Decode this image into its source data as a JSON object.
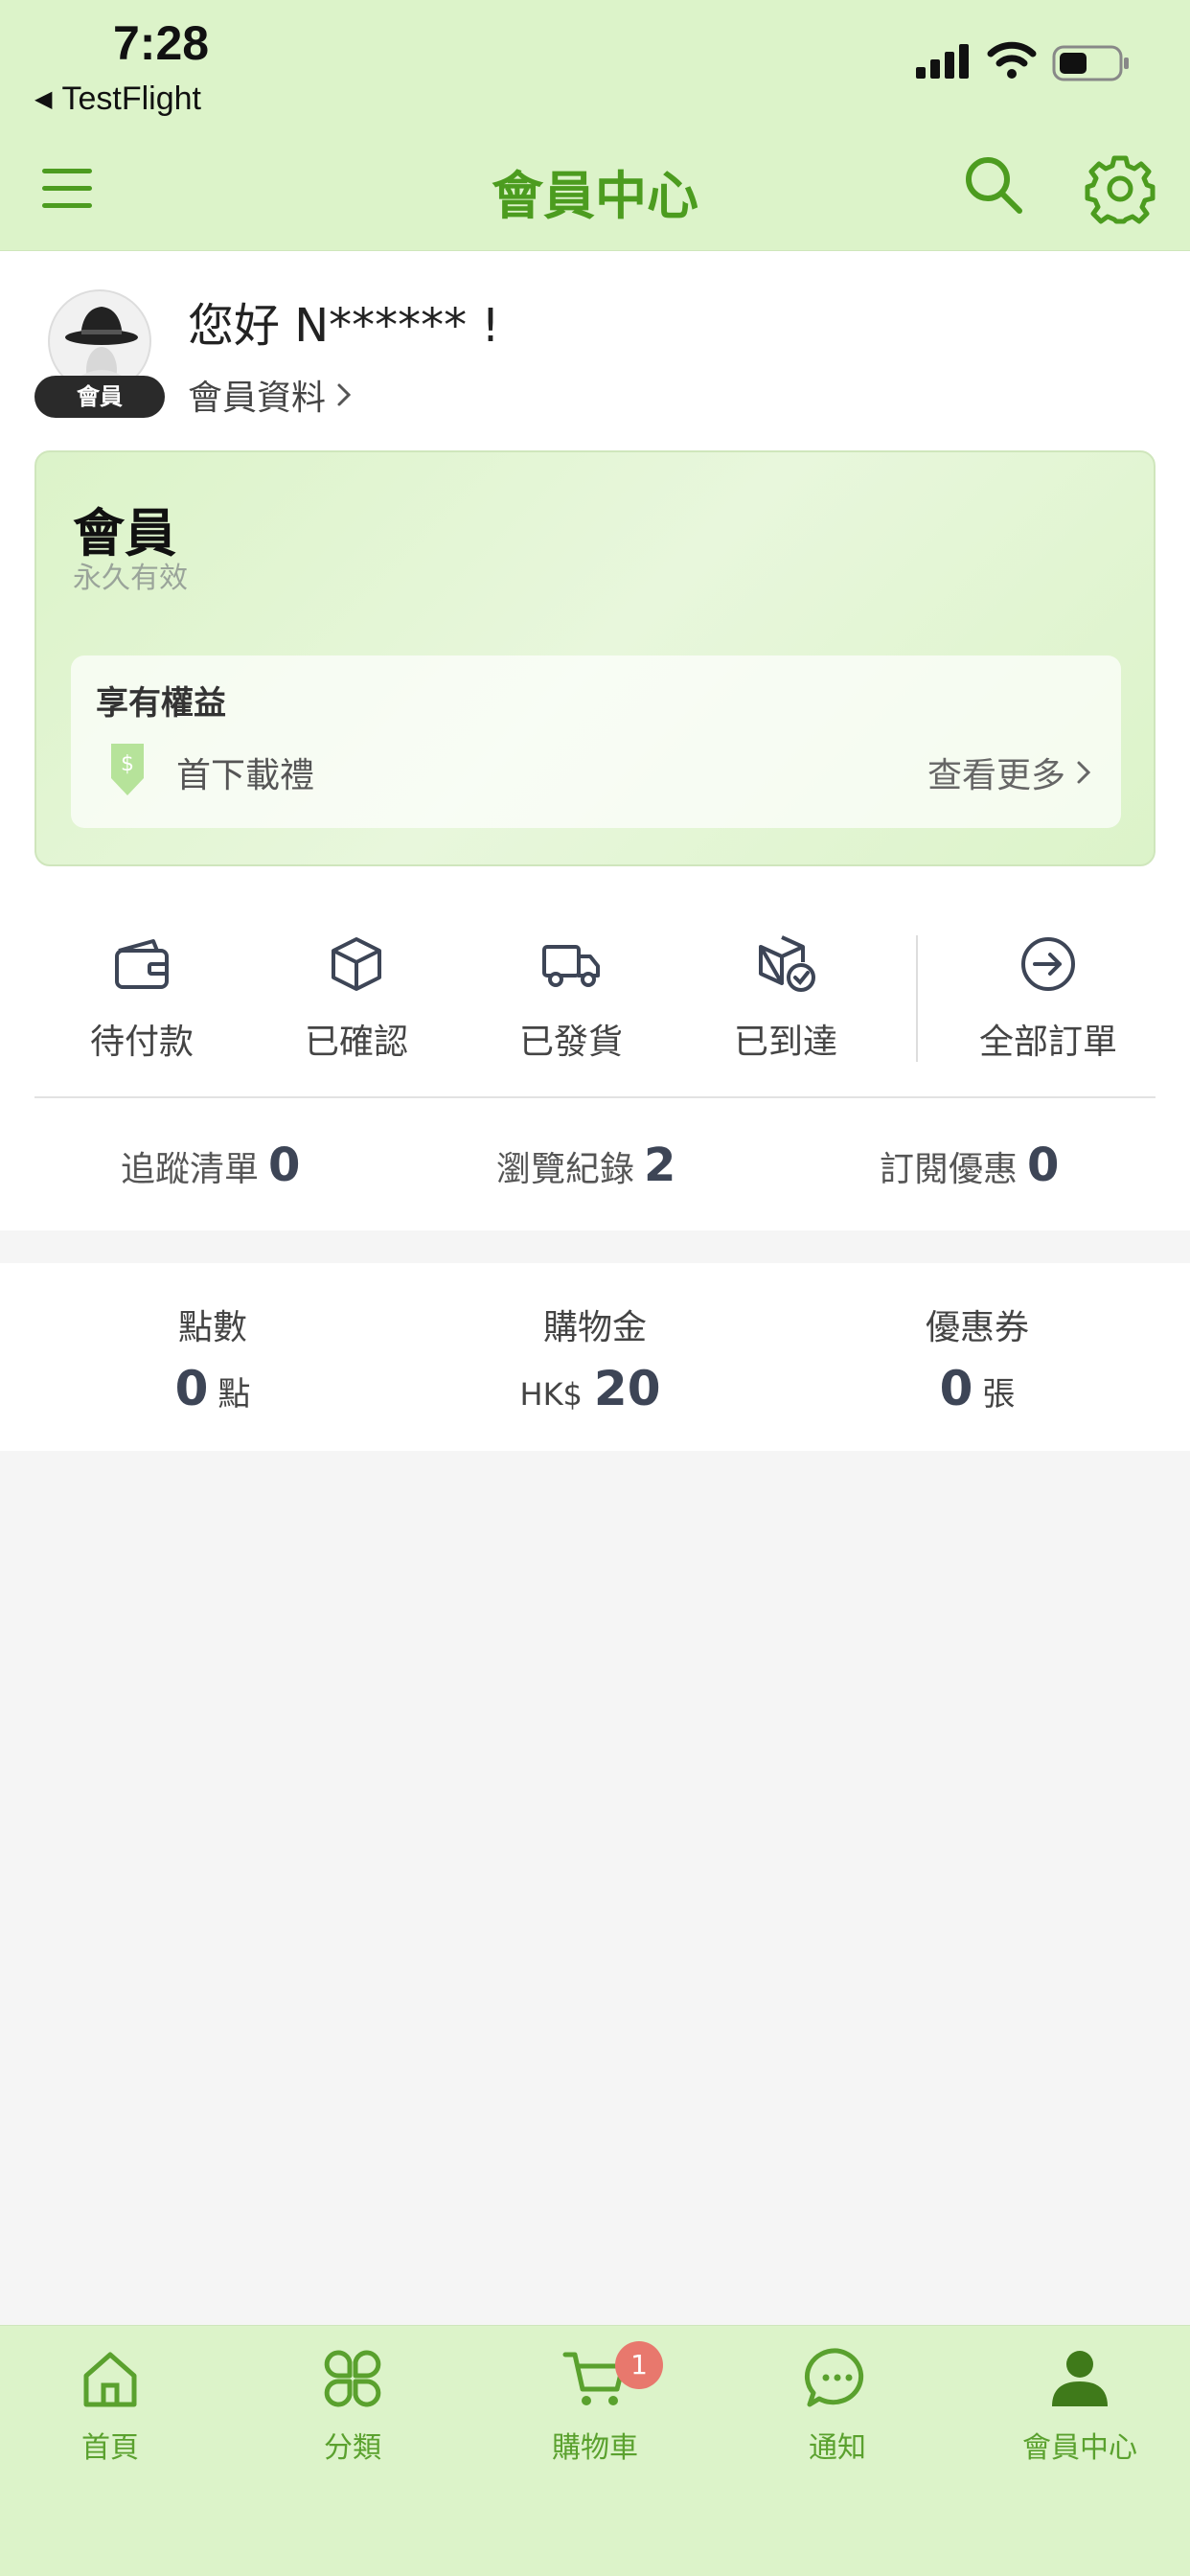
{
  "status_bar": {
    "time": "7:28",
    "back_app": "TestFlight"
  },
  "header": {
    "title": "會員中心"
  },
  "profile": {
    "avatar_badge": "會員",
    "greeting": "您好 N****** !",
    "profile_link": "會員資料"
  },
  "membership": {
    "level": "會員",
    "validity": "永久有效",
    "benefits_title": "享有權益",
    "benefit_item": "首下載禮",
    "see_more": "查看更多"
  },
  "orders": [
    {
      "label": "待付款",
      "icon": "wallet-icon"
    },
    {
      "label": "已確認",
      "icon": "box-icon"
    },
    {
      "label": "已發貨",
      "icon": "truck-icon"
    },
    {
      "label": "已到達",
      "icon": "box-check-icon"
    },
    {
      "label": "全部訂單",
      "icon": "arrow-circle-right-icon"
    }
  ],
  "stats": {
    "tracking": {
      "label": "追蹤清單",
      "value": "0"
    },
    "history": {
      "label": "瀏覽紀錄",
      "value": "2"
    },
    "subscriptions": {
      "label": "訂閱優惠",
      "value": "0"
    }
  },
  "wallet": {
    "points": {
      "label": "點數",
      "value": "0",
      "unit": "點"
    },
    "credit": {
      "label": "購物金",
      "currency": "HK$",
      "value": "20"
    },
    "coupons": {
      "label": "優惠券",
      "value": "0",
      "unit": "張"
    }
  },
  "tabs": [
    {
      "label": "首頁",
      "icon": "home-icon"
    },
    {
      "label": "分類",
      "icon": "grid-icon"
    },
    {
      "label": "購物車",
      "icon": "cart-icon",
      "badge": "1"
    },
    {
      "label": "通知",
      "icon": "chat-icon"
    },
    {
      "label": "會員中心",
      "icon": "user-icon"
    }
  ],
  "colors": {
    "accent": "#4c9c1f",
    "header_bg": "#dcf3c9",
    "badge": "#e8786d"
  }
}
